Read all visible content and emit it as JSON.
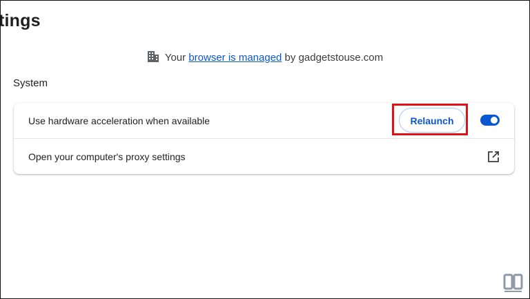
{
  "header": {
    "title": "tings"
  },
  "managed_notice": {
    "prefix": "Your ",
    "link": "browser is managed",
    "suffix": " by gadgetstouse.com",
    "icon": "building-icon"
  },
  "section": {
    "label": "System"
  },
  "settings": {
    "hardware_acceleration": {
      "label": "Use hardware acceleration when available",
      "relaunch_label": "Relaunch",
      "enabled": true
    },
    "proxy": {
      "label": "Open your computer's proxy settings",
      "icon": "open-in-new-icon"
    }
  },
  "colors": {
    "accent": "#0b57d0",
    "highlight": "#e01016"
  },
  "watermark": {
    "icon": "gadgetstouse-logo"
  }
}
